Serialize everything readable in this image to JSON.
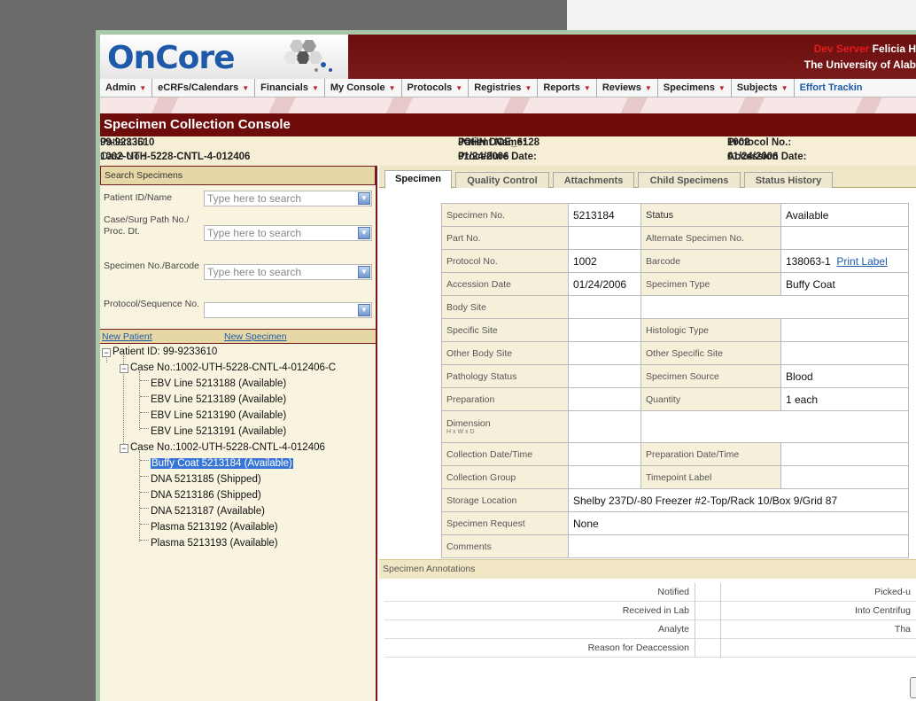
{
  "app": {
    "logo": "OnCore",
    "server_label": "Dev Server",
    "user": "Felicia H",
    "organization": "The University of Alab"
  },
  "nav": [
    {
      "label": "Admin",
      "dropdown": true
    },
    {
      "label": "eCRFs/Calendars",
      "dropdown": true
    },
    {
      "label": "Financials",
      "dropdown": true
    },
    {
      "label": "My Console",
      "dropdown": true
    },
    {
      "label": "Protocols",
      "dropdown": true
    },
    {
      "label": "Registries",
      "dropdown": true
    },
    {
      "label": "Reports",
      "dropdown": true
    },
    {
      "label": "Reviews",
      "dropdown": true
    },
    {
      "label": "Specimens",
      "dropdown": true
    },
    {
      "label": "Subjects",
      "dropdown": true
    },
    {
      "label": "Effort Trackin",
      "dropdown": false
    }
  ],
  "page_title": "Specimen Collection Console",
  "patient_info": {
    "patient_id_label": "Patient ID:",
    "patient_id": "99-9233610",
    "case_no_label": "Case No.:",
    "case_no": "1002-UTH-5228-CNTL-4-012406",
    "patient_name_label": "Patient Name:",
    "patient_name": "JOHN DOE_6128",
    "procedure_date_label": "Procedure Date:",
    "procedure_date": "01/24/2006",
    "protocol_no_label": "Protocol No.:",
    "protocol_no": "1002",
    "accession_date_label": "Accession Date:",
    "accession_date": "01/24/2006"
  },
  "search": {
    "header": "Search Specimens",
    "fields": [
      {
        "label": "Patient ID/Name",
        "placeholder": "Type here to search"
      },
      {
        "label": "Case/Surg Path No./ Proc. Dt.",
        "placeholder": "Type here to search"
      },
      {
        "label": "Specimen No./Barcode",
        "placeholder": "Type here to search"
      },
      {
        "label": "Protocol/Sequence No.",
        "placeholder": ""
      }
    ],
    "new_patient": "New Patient",
    "new_specimen": "New Specimen"
  },
  "tree": {
    "patient": "Patient ID: 99-9233610",
    "cases": [
      {
        "label": "Case No.:1002-UTH-5228-CNTL-4-012406-C",
        "items": [
          "EBV Line 5213188 (Available)",
          "EBV Line 5213189 (Available)",
          "EBV Line 5213190 (Available)",
          "EBV Line 5213191 (Available)"
        ]
      },
      {
        "label": "Case No.:1002-UTH-5228-CNTL-4-012406",
        "items": [
          "Buffy Coat 5213184 (Available)",
          "DNA 5213185 (Shipped)",
          "DNA 5213186 (Shipped)",
          "DNA 5213187 (Available)",
          "Plasma 5213192 (Available)",
          "Plasma 5213193 (Available)"
        ]
      }
    ],
    "selected": "Buffy Coat 5213184 (Available)"
  },
  "tabs": [
    "Specimen",
    "Quality Control",
    "Attachments",
    "Child Specimens",
    "Status History"
  ],
  "active_tab": "Specimen",
  "specimen": {
    "specimen_no_label": "Specimen No.",
    "specimen_no": "5213184",
    "status_label": "Status",
    "status": "Available",
    "part_no_label": "Part No.",
    "part_no": "",
    "alt_specimen_label": "Alternate Specimen No.",
    "alt_specimen": "",
    "protocol_no_label": "Protocol No.",
    "protocol_no": "1002",
    "barcode_label": "Barcode",
    "barcode": "138063-1",
    "print_label": "Print Label",
    "accession_date_label": "Accession Date",
    "accession_date": "01/24/2006",
    "specimen_type_label": "Specimen Type",
    "specimen_type": "Buffy Coat",
    "body_site_label": "Body Site",
    "specific_site_label": "Specific Site",
    "histologic_type_label": "Histologic Type",
    "other_body_site_label": "Other Body Site",
    "other_specific_site_label": "Other Specific Site",
    "pathology_status_label": "Pathology Status",
    "specimen_source_label": "Specimen Source",
    "specimen_source": "Blood",
    "preparation_label": "Preparation",
    "quantity_label": "Quantity",
    "quantity": "1 each",
    "dimension_label": "Dimension",
    "dimension_sub": "H x W x D",
    "collection_dt_label": "Collection Date/Time",
    "prep_dt_label": "Preparation Date/Time",
    "collection_group_label": "Collection Group",
    "timepoint_label": "Timepoint Label",
    "storage_label": "Storage Location",
    "storage": "Shelby 237D/-80 Freezer #2-Top/Rack 10/Box 9/Grid 87",
    "request_label": "Specimen Request",
    "request": "None",
    "comments_label": "Comments"
  },
  "annotations": {
    "header": "Specimen Annotations",
    "rows": [
      {
        "a": "Notified",
        "b": "Picked-u"
      },
      {
        "a": "Received in Lab",
        "b": "Into Centrifug"
      },
      {
        "a": "Analyte",
        "b": "Tha"
      },
      {
        "a": "Reason for Deaccession",
        "b": ""
      }
    ]
  }
}
